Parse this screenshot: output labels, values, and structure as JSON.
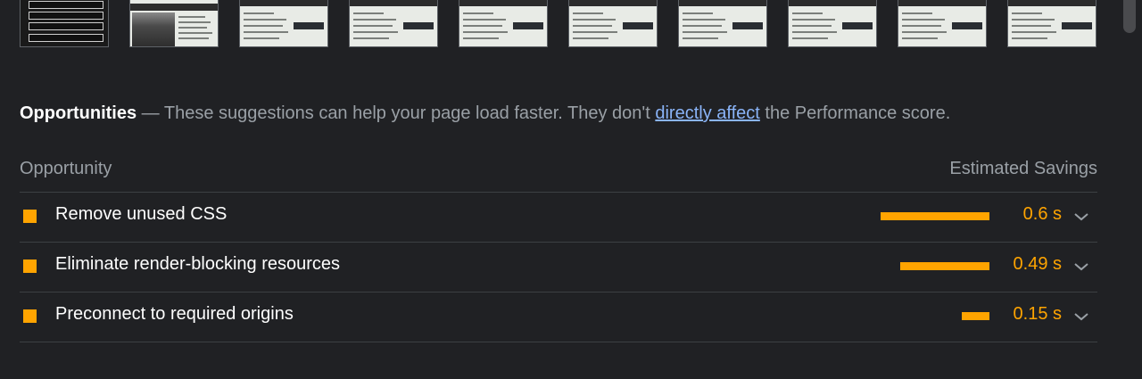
{
  "filmstrip": {
    "frame_count": 10
  },
  "opportunities": {
    "title": "Opportunities",
    "dash": "—",
    "description_before": "These suggestions can help your page load faster. They don't",
    "link_text": "directly affect",
    "description_after": "the Performance score."
  },
  "table": {
    "col_opportunity": "Opportunity",
    "col_savings": "Estimated Savings"
  },
  "rows": [
    {
      "label": "Remove unused CSS",
      "savings": "0.6 s",
      "savings_seconds": 0.6
    },
    {
      "label": "Eliminate render-blocking resources",
      "savings": "0.49 s",
      "savings_seconds": 0.49
    },
    {
      "label": "Preconnect to required origins",
      "savings": "0.15 s",
      "savings_seconds": 0.15
    }
  ],
  "colors": {
    "background": "#202124",
    "accent_average": "#ffa400",
    "link": "#8ab4f8",
    "muted_text": "#9aa0a6"
  },
  "icons": {
    "row_marker": "orange-square-icon",
    "expand": "chevron-down-icon"
  }
}
